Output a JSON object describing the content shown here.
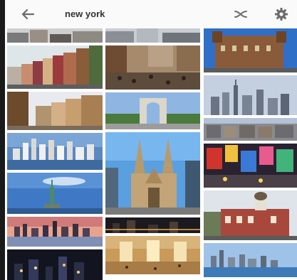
{
  "search": {
    "query": "new york"
  },
  "icons": {
    "back": "arrow-left-icon",
    "clear": "shuffle-close-icon",
    "settings": "gear-icon"
  },
  "colors": {
    "toolbar_bg": "#fafafa",
    "icon": "#6b6b6b",
    "text": "#333333"
  },
  "results": {
    "column1": [
      "street-buildings",
      "colorful-row-houses",
      "city-street",
      "skyline-water",
      "statue-of-liberty",
      "skyline-sunset",
      "night-city"
    ],
    "column2": [
      "street-view",
      "crowded-market",
      "washington-square-arch",
      "gothic-cathedral",
      "night-skyline",
      "grand-central-terminal"
    ],
    "column3": [
      "historic-building",
      "city-skyline",
      "aerial-city",
      "times-square",
      "brick-building",
      "skyline-harbor"
    ]
  }
}
